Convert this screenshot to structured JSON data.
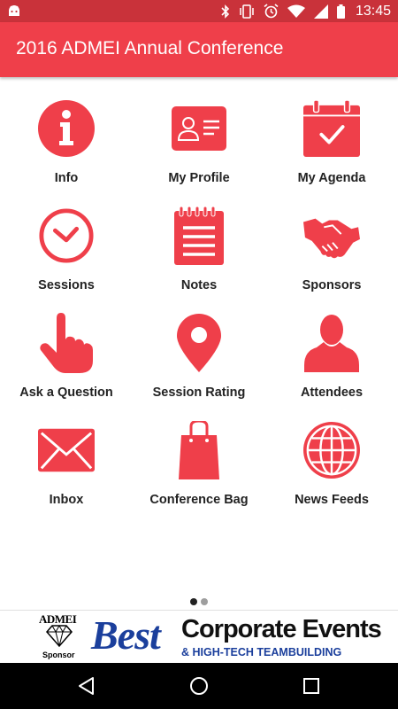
{
  "status_bar": {
    "time": "13:45",
    "icons": [
      "android-icon",
      "bluetooth-icon",
      "vibrate-icon",
      "alarm-icon",
      "wifi-icon",
      "signal-icon",
      "battery-icon"
    ]
  },
  "app_bar": {
    "title": "2016 ADMEI Annual Conference"
  },
  "accent_color": "#ef3f4a",
  "menu": [
    {
      "label": "Info",
      "icon": "info-icon"
    },
    {
      "label": "My Profile",
      "icon": "profile-card-icon"
    },
    {
      "label": "My Agenda",
      "icon": "calendar-check-icon"
    },
    {
      "label": "Sessions",
      "icon": "clock-icon"
    },
    {
      "label": "Notes",
      "icon": "notepad-icon"
    },
    {
      "label": "Sponsors",
      "icon": "handshake-icon"
    },
    {
      "label": "Ask a Question",
      "icon": "pointing-hand-icon"
    },
    {
      "label": "Session Rating",
      "icon": "map-pin-icon"
    },
    {
      "label": "Attendees",
      "icon": "person-icon"
    },
    {
      "label": "Inbox",
      "icon": "envelope-icon"
    },
    {
      "label": "Conference Bag",
      "icon": "shopping-bag-icon"
    },
    {
      "label": "News Feeds",
      "icon": "globe-icon"
    }
  ],
  "pager": {
    "pages": 2,
    "current": 1
  },
  "sponsor_banner": {
    "admei": "ADMEI",
    "sponsor_label": "Sponsor",
    "best": "Best",
    "corporate": "Corporate Events",
    "tagline": "& HIGH-TECH TEAMBUILDING"
  },
  "nav_bar": {
    "buttons": [
      "back-icon",
      "home-icon",
      "recents-icon"
    ]
  }
}
